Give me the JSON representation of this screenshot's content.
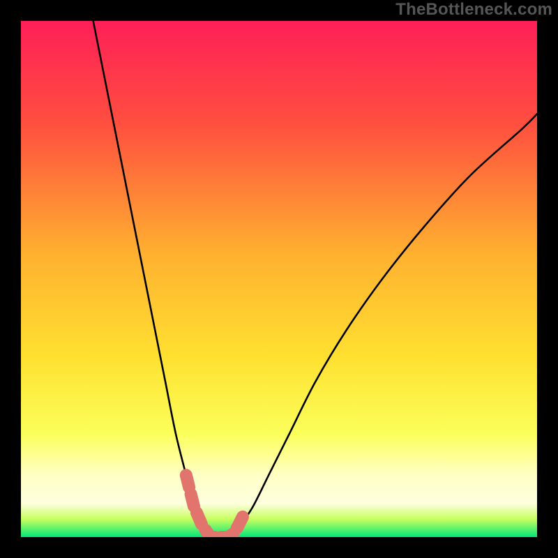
{
  "attribution": "TheBottleneck.com",
  "chart_data": {
    "type": "line",
    "title": "",
    "xlabel": "",
    "ylabel": "",
    "xlim": [
      0,
      100
    ],
    "ylim": [
      0,
      100
    ],
    "series": [
      {
        "name": "left-curve",
        "x": [
          14,
          16,
          18,
          20,
          22,
          24,
          26,
          28,
          30,
          32,
          33.5,
          35,
          36,
          36.8
        ],
        "values": [
          100,
          90,
          80,
          70,
          60,
          50,
          40,
          30,
          20,
          12,
          6,
          2.5,
          1,
          0
        ]
      },
      {
        "name": "right-curve",
        "x": [
          40,
          41.5,
          43,
          45,
          48,
          52,
          57,
          63,
          70,
          78,
          87,
          97,
          100
        ],
        "values": [
          0,
          1,
          3,
          6,
          12,
          20,
          30,
          40,
          50,
          60,
          70,
          79,
          82
        ]
      },
      {
        "name": "highlight-segment",
        "x": [
          32,
          33.5,
          35,
          36,
          36.8,
          38.5,
          40,
          41,
          42,
          43
        ],
        "values": [
          12,
          6,
          2.5,
          1,
          0,
          0,
          0,
          0.5,
          2,
          4
        ]
      }
    ],
    "floor_band": {
      "from_y": 0,
      "to_y": 3.5,
      "color_top": "#9eff30",
      "color_bottom": "#00f07a"
    },
    "gradient_stops": [
      {
        "offset": 0.0,
        "color": "#ff1f57"
      },
      {
        "offset": 0.2,
        "color": "#ff4f3f"
      },
      {
        "offset": 0.45,
        "color": "#ffb030"
      },
      {
        "offset": 0.65,
        "color": "#ffe030"
      },
      {
        "offset": 0.8,
        "color": "#fbff5a"
      },
      {
        "offset": 0.88,
        "color": "#ffffc4"
      },
      {
        "offset": 0.935,
        "color": "#fdffde"
      },
      {
        "offset": 0.965,
        "color": "#c8ff60"
      },
      {
        "offset": 1.0,
        "color": "#00e878"
      }
    ],
    "highlight_color": "#e1746d",
    "curve_color": "#000000"
  },
  "layout": {
    "image_size": 800,
    "plot_inset": 30,
    "plot_size": 740
  }
}
